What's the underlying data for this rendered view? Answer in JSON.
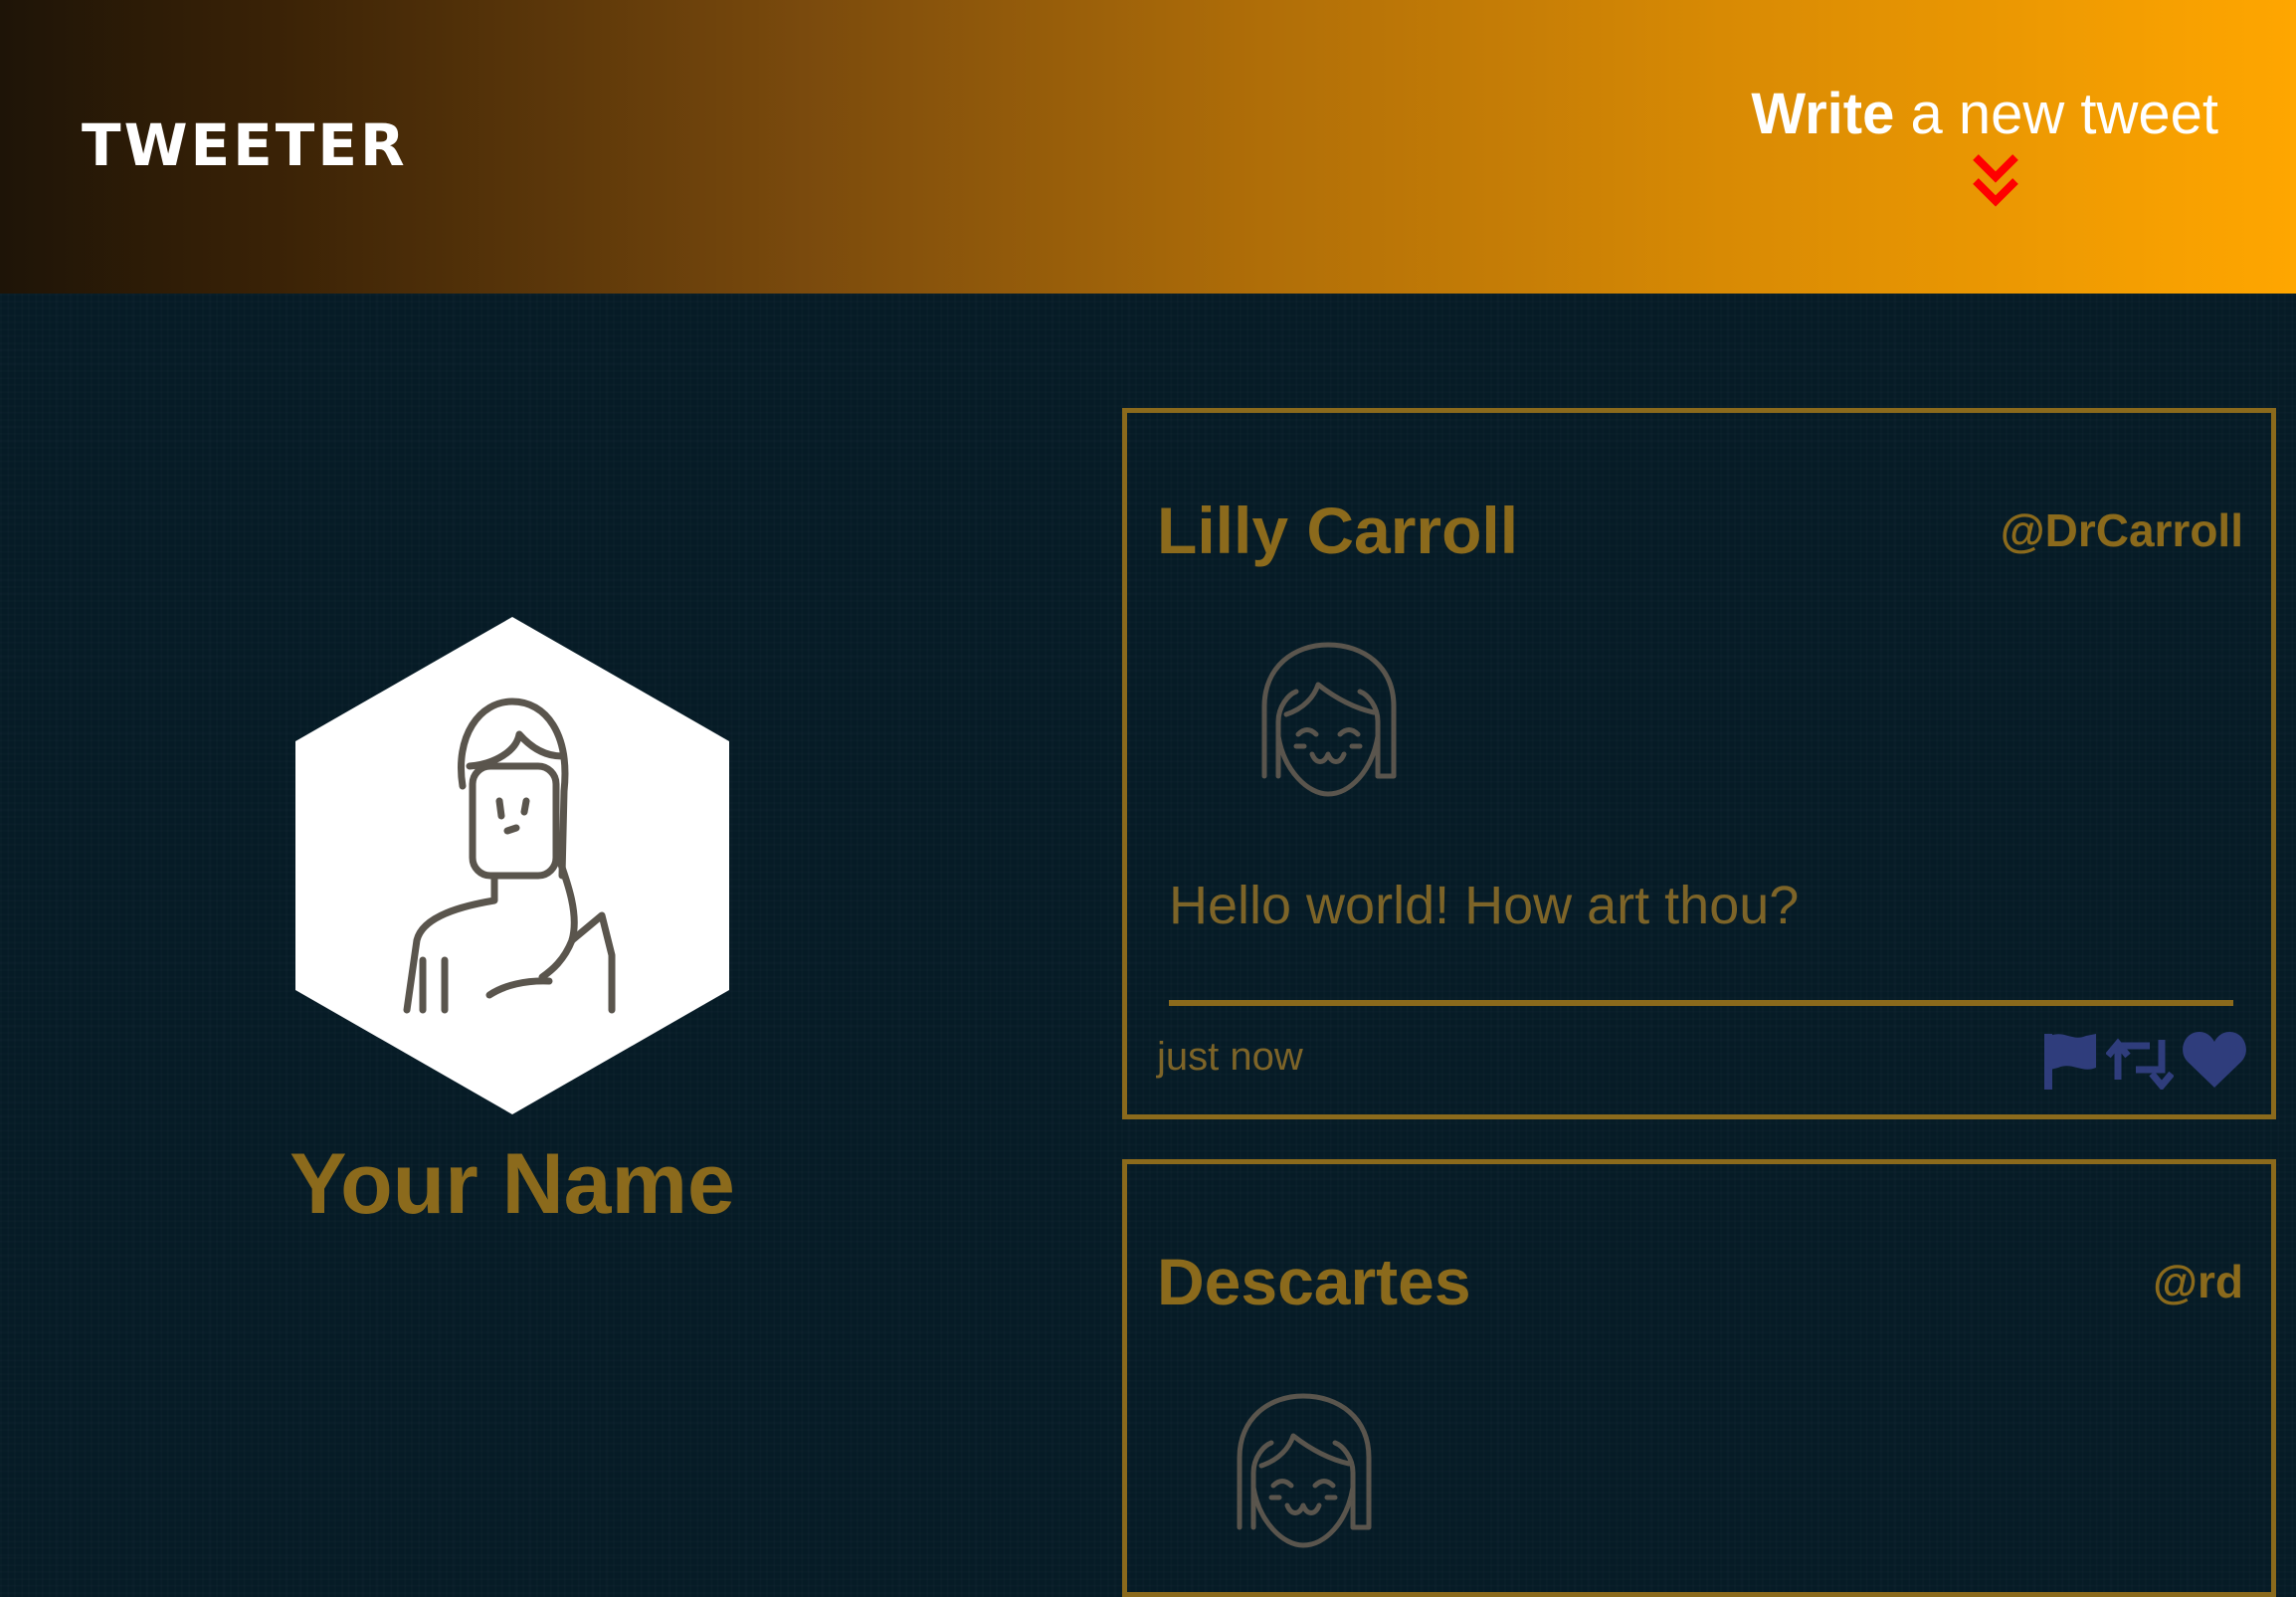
{
  "header": {
    "brand": "TWEETER",
    "compose_strong": "Write",
    "compose_rest": " a new tweet",
    "gradient": [
      "#1e1407",
      "#ffa600"
    ],
    "chevron_color": "#ff0000"
  },
  "profile": {
    "name": "Your Name",
    "avatar_icon": "user-avatar-icon"
  },
  "tweets": [
    {
      "name": "Lilly Carroll",
      "handle": "@DrCarroll",
      "content": "Hello world! How art thou?",
      "time": "just now",
      "avatar_icon": "user-avatar-icon"
    },
    {
      "name": "Descartes",
      "handle": "@rd",
      "avatar_icon": "user-avatar-icon"
    }
  ],
  "actions": [
    "flag-icon",
    "retweet-icon",
    "heart-icon"
  ],
  "colors": {
    "background": "#061b26",
    "accent": "#8b6a1c",
    "action": "#2f3d7c",
    "hex_fill": "#ffffff"
  }
}
